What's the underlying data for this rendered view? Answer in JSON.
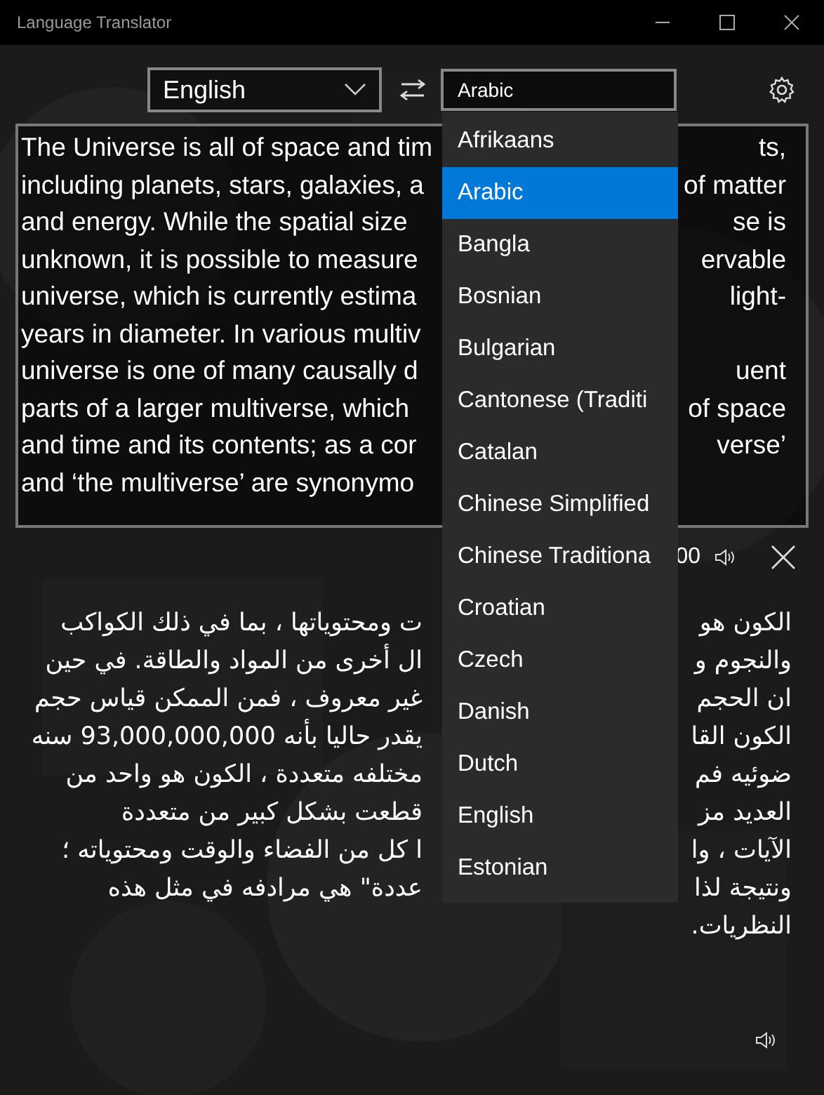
{
  "window": {
    "title": "Language Translator"
  },
  "source_language": {
    "value": "English"
  },
  "target_language": {
    "value": "Arabic",
    "expanded": true
  },
  "source_text": {
    "lines": [
      {
        "left": "The Universe is all of space and tim",
        "right": "ts,"
      },
      {
        "left": "including planets, stars, galaxies, a",
        "right": "of matter"
      },
      {
        "left": "and energy. While the spatial size",
        "right": "se is"
      },
      {
        "left": "unknown, it is possible to measure",
        "right": "ervable"
      },
      {
        "left": "universe, which is currently estima",
        "right": "light-"
      },
      {
        "left": "years in diameter. In various multiv"
      },
      {
        "left": "universe is one of many causally d",
        "right": "uent"
      },
      {
        "left": "parts of a larger multiverse, which",
        "right": "of space"
      },
      {
        "left": "and time and its contents; as a cor",
        "right": "verse’"
      },
      {
        "left": "and ‘the multiverse’ are synonymo"
      }
    ]
  },
  "source_footer": {
    "count": "00"
  },
  "translation": {
    "lines": [
      {
        "start": "الكون هو",
        "end": "ت ومحتوياتها ، بما في ذلك الكواكب"
      },
      {
        "start": "والنجوم و",
        "end": "ال أخرى من المواد والطاقة. في حين"
      },
      {
        "start": "ان الحجم",
        "end": "غير معروف ، فمن الممكن قياس حجم"
      },
      {
        "start": "الكون القا",
        "end": "يقدر حاليا بأنه 93,000,000,000 سنه"
      },
      {
        "start": "ضوئيه فم",
        "end": "مختلفه متعددة ، الكون هو واحد من"
      },
      {
        "start": "العديد مز",
        "end": "قطعت بشكل كبير من متعددة"
      },
      {
        "start": "الآيات ، وا",
        "end": "ا كل من الفضاء والوقت ومحتوياته ؛"
      },
      {
        "start": "ونتيجة لذا",
        "end": "عددة\" هي مرادفه في مثل هذه"
      },
      {
        "start": "النظريات."
      }
    ]
  },
  "language_menu": {
    "items": [
      {
        "label": "Afrikaans",
        "selected": false
      },
      {
        "label": "Arabic",
        "selected": true
      },
      {
        "label": "Bangla",
        "selected": false
      },
      {
        "label": "Bosnian",
        "selected": false
      },
      {
        "label": "Bulgarian",
        "selected": false
      },
      {
        "label": "Cantonese (Traditi",
        "selected": false
      },
      {
        "label": "Catalan",
        "selected": false
      },
      {
        "label": "Chinese Simplified",
        "selected": false
      },
      {
        "label": "Chinese Traditiona",
        "selected": false
      },
      {
        "label": "Croatian",
        "selected": false
      },
      {
        "label": "Czech",
        "selected": false
      },
      {
        "label": "Danish",
        "selected": false
      },
      {
        "label": "Dutch",
        "selected": false
      },
      {
        "label": "English",
        "selected": false
      },
      {
        "label": "Estonian",
        "selected": false
      }
    ]
  }
}
